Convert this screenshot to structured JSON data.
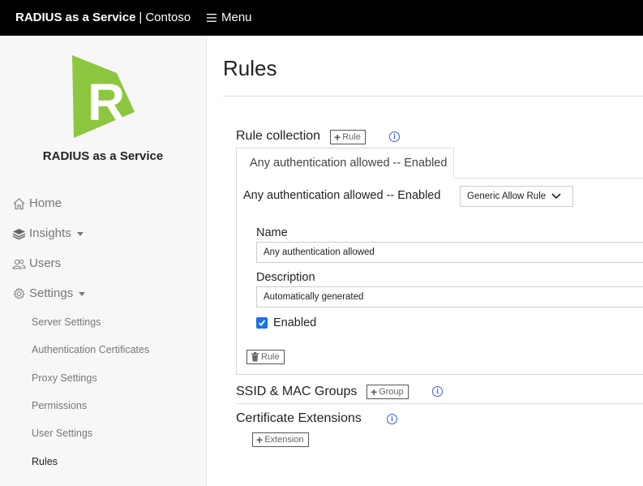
{
  "header": {
    "brand_bold": "RADIUS as a Service",
    "brand_sep": "|",
    "brand_org": "Contoso",
    "menu_label": "Menu"
  },
  "sidebar": {
    "title": "RADIUS as a Service",
    "logo_letter": "R",
    "nav": [
      {
        "label": "Home",
        "icon": "home-icon"
      },
      {
        "label": "Insights",
        "icon": "layers-icon"
      },
      {
        "label": "Users",
        "icon": "users-icon"
      },
      {
        "label": "Settings",
        "icon": "gear-icon"
      }
    ],
    "settings_items": [
      {
        "label": "Server Settings"
      },
      {
        "label": "Authentication Certificates"
      },
      {
        "label": "Proxy Settings"
      },
      {
        "label": "Permissions"
      },
      {
        "label": "User Settings"
      },
      {
        "label": "Rules"
      }
    ]
  },
  "main": {
    "title": "Rules",
    "rule_collection": {
      "heading": "Rule collection",
      "add_label": "Rule",
      "tab_label": "Any authentication allowed -- Enabled",
      "rule_title": "Any authentication allowed -- Enabled",
      "rule_type": "Generic Allow Rule",
      "name_label": "Name",
      "name_value": "Any authentication allowed",
      "description_label": "Description",
      "description_value": "Automatically generated",
      "enabled_label": "Enabled",
      "enabled": true,
      "delete_label": "Rule"
    },
    "ssid_groups": {
      "heading": "SSID & MAC Groups",
      "add_label": "Group"
    },
    "cert_extensions": {
      "heading": "Certificate Extensions",
      "add_label": "Extension"
    }
  },
  "colors": {
    "topbar": "#000000",
    "logo_green": "#8dc63f",
    "checkbox_blue": "#1a73e8",
    "info_blue": "#3b5bdb"
  }
}
